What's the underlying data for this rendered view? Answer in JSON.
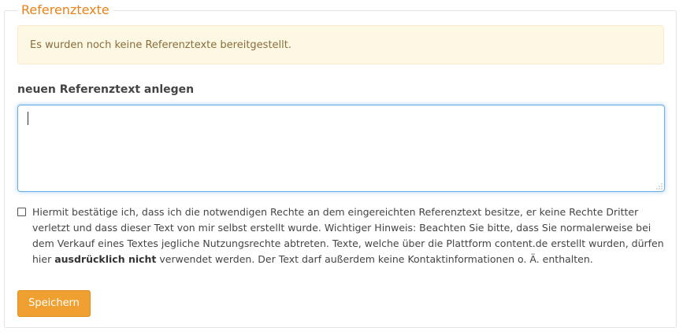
{
  "panel": {
    "legend": "Referenztexte"
  },
  "alert": {
    "message": "Es wurden noch keine Referenztexte bereitgestellt."
  },
  "form": {
    "label": "neuen Referenztext anlegen",
    "textarea_value": "",
    "consent_part1": "Hiermit bestätige ich, dass ich die notwendigen Rechte an dem eingereichten Referenztext besitze, er keine Rechte Dritter verletzt und dass dieser Text von mir selbst erstellt wurde. Wichtiger Hinweis: Beachten Sie bitte, dass Sie normalerweise bei dem Verkauf eines Textes jegliche Nutzungsrechte abtreten. Texte, welche über die Plattform content.de erstellt wurden, dürfen hier ",
    "consent_emphasis": "ausdrücklich nicht",
    "consent_part2": " verwendet werden. Der Text darf außerdem keine Kontaktinformationen o. Ä. enthalten.",
    "consent_checked": false,
    "save_label": "Speichern"
  },
  "colors": {
    "accent": "#e8821a",
    "button": "#f0a030",
    "alert_bg": "#fcf8e3",
    "alert_text": "#8a6d3b",
    "focus_border": "#66afe9"
  }
}
